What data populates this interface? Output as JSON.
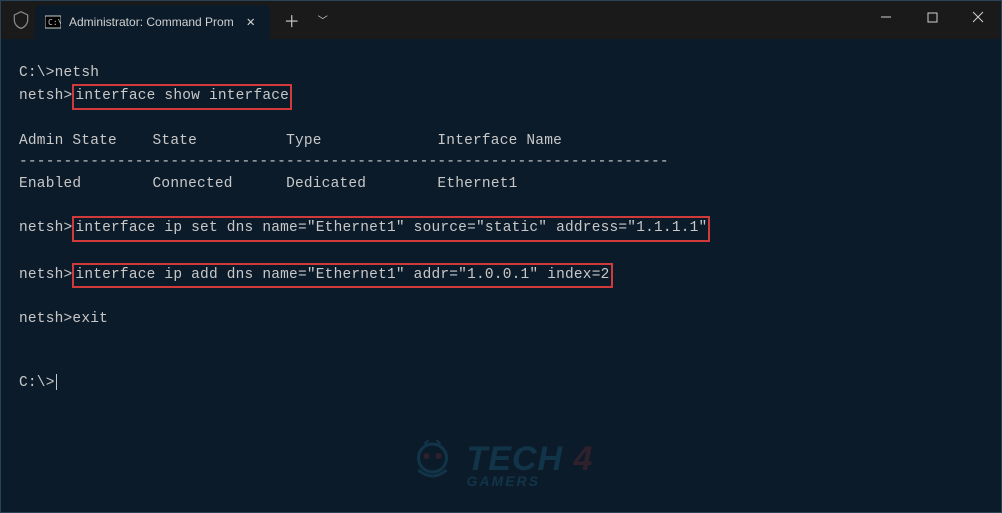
{
  "titlebar": {
    "tab_title": "Administrator: Command Prom",
    "close_label": "✕",
    "new_tab_label": "＋",
    "dropdown_label": "﹀",
    "minimize_label": "—",
    "maximize_label": "☐",
    "window_close_label": "✕"
  },
  "terminal": {
    "line1_prompt": "C:\\>",
    "line1_cmd": "netsh",
    "line2_prompt": "netsh>",
    "line2_cmd": "interface show interface",
    "header_admin": "Admin State",
    "header_state": "State",
    "header_type": "Type",
    "header_iface": "Interface Name",
    "divider": "-------------------------------------------------------------------------",
    "row_admin": "Enabled",
    "row_state": "Connected",
    "row_type": "Dedicated",
    "row_iface": "Ethernet1",
    "line_set_prompt": "netsh>",
    "line_set_cmd": "interface ip set dns name=\"Ethernet1\" source=\"static\" address=\"1.1.1.1\"",
    "line_add_prompt": "netsh>",
    "line_add_cmd": "interface ip add dns name=\"Ethernet1\" addr=\"1.0.0.1\" index=2",
    "line_exit_prompt": "netsh>",
    "line_exit_cmd": "exit",
    "final_prompt": "C:\\>"
  },
  "watermark": {
    "brand": "TECH",
    "four": "4",
    "sub": "GAMERS"
  }
}
